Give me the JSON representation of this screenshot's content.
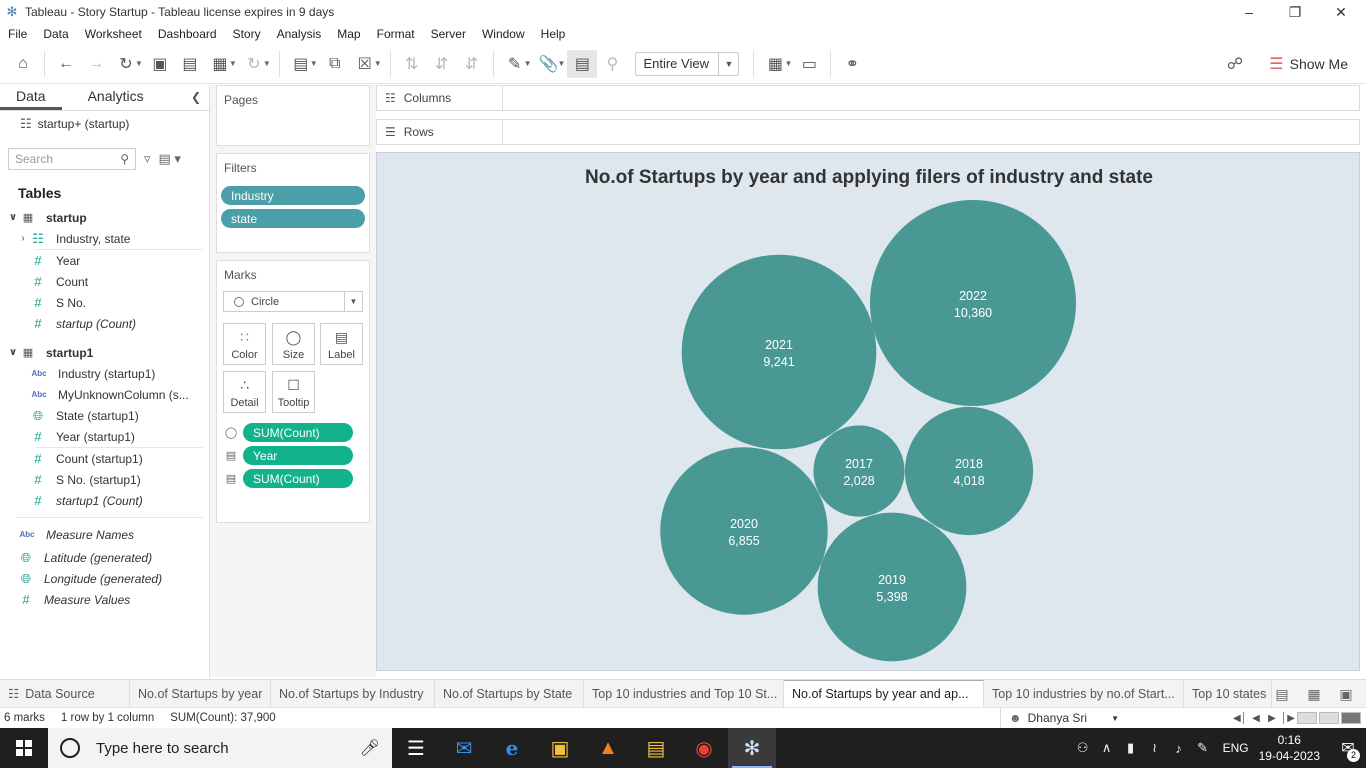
{
  "window": {
    "title": "Tableau - Story Startup - Tableau license expires in 9 days"
  },
  "menu": [
    "File",
    "Data",
    "Worksheet",
    "Dashboard",
    "Story",
    "Analysis",
    "Map",
    "Format",
    "Server",
    "Window",
    "Help"
  ],
  "toolbar": {
    "view_mode": "Entire View",
    "show_me": "Show Me"
  },
  "data_pane": {
    "tabs": [
      "Data",
      "Analytics"
    ],
    "datasource": "startup+ (startup)",
    "search_placeholder": "Search",
    "tables_label": "Tables",
    "tables": [
      {
        "name": "startup",
        "fields": [
          {
            "label": "Industry, state",
            "icon": "hierarchy-icon"
          },
          {
            "label": "Year",
            "icon": "number-icon"
          },
          {
            "label": "Count",
            "icon": "number-icon"
          },
          {
            "label": "S No.",
            "icon": "number-icon"
          },
          {
            "label": "startup (Count)",
            "icon": "number-icon"
          }
        ]
      },
      {
        "name": "startup1",
        "fields": [
          {
            "label": "Industry (startup1)",
            "icon": "string-icon"
          },
          {
            "label": "MyUnknownColumn (s...",
            "icon": "string-icon"
          },
          {
            "label": "State (startup1)",
            "icon": "geo-icon"
          },
          {
            "label": "Year (startup1)",
            "icon": "number-icon"
          },
          {
            "label": "Count (startup1)",
            "icon": "number-icon"
          },
          {
            "label": "S No. (startup1)",
            "icon": "number-icon"
          },
          {
            "label": "startup1 (Count)",
            "icon": "number-icon"
          }
        ]
      }
    ],
    "extra_fields": [
      {
        "label": "Measure Names",
        "icon": "string-icon"
      },
      {
        "label": "Latitude (generated)",
        "icon": "geo-icon"
      },
      {
        "label": "Longitude (generated)",
        "icon": "geo-icon"
      },
      {
        "label": "Measure Values",
        "icon": "number-icon"
      }
    ]
  },
  "cards": {
    "pages_title": "Pages",
    "filters_title": "Filters",
    "filters": [
      "Industry",
      "state"
    ],
    "marks_title": "Marks",
    "mark_type": "Circle",
    "mark_buttons": [
      "Color",
      "Size",
      "Label",
      "Detail",
      "Tooltip"
    ],
    "mark_pills": [
      {
        "icon": "size-icon",
        "label": "SUM(Count)"
      },
      {
        "icon": "label-icon",
        "label": "Year"
      },
      {
        "icon": "label-icon",
        "label": "SUM(Count)"
      }
    ]
  },
  "shelves": {
    "columns": "Columns",
    "rows": "Rows"
  },
  "viz": {
    "title": "No.of Startups by year and applying filers of industry and state"
  },
  "chart_data": {
    "type": "bubble",
    "title": "No.of Startups by year and applying filers of industry and state",
    "categories": [
      "2017",
      "2018",
      "2019",
      "2020",
      "2021",
      "2022"
    ],
    "values": [
      2028,
      4018,
      5398,
      6855,
      9241,
      10360
    ],
    "value_labels": [
      "2,028",
      "4,018",
      "5,398",
      "6,855",
      "9,241",
      "10,360"
    ],
    "color": "#4a9894",
    "background": "#dde7ed"
  },
  "sheet_tabs": [
    "Data Source",
    "No.of Startups by year",
    "No.of Startups by Industry",
    "No.of Startups by State",
    "Top 10 industries and Top 10 St...",
    "No.of Startups by year and ap...",
    "Top 10 industries by no.of Start...",
    "Top 10 states"
  ],
  "active_sheet_index": 5,
  "status": {
    "marks": "6 marks",
    "dims": "1 row by 1 column",
    "sum": "SUM(Count): 37,900",
    "user": "Dhanya Sri"
  },
  "taskbar": {
    "search_placeholder": "Type here to search",
    "lang": "ENG",
    "time": "0:16",
    "date": "19-04-2023",
    "notifications": "2"
  }
}
